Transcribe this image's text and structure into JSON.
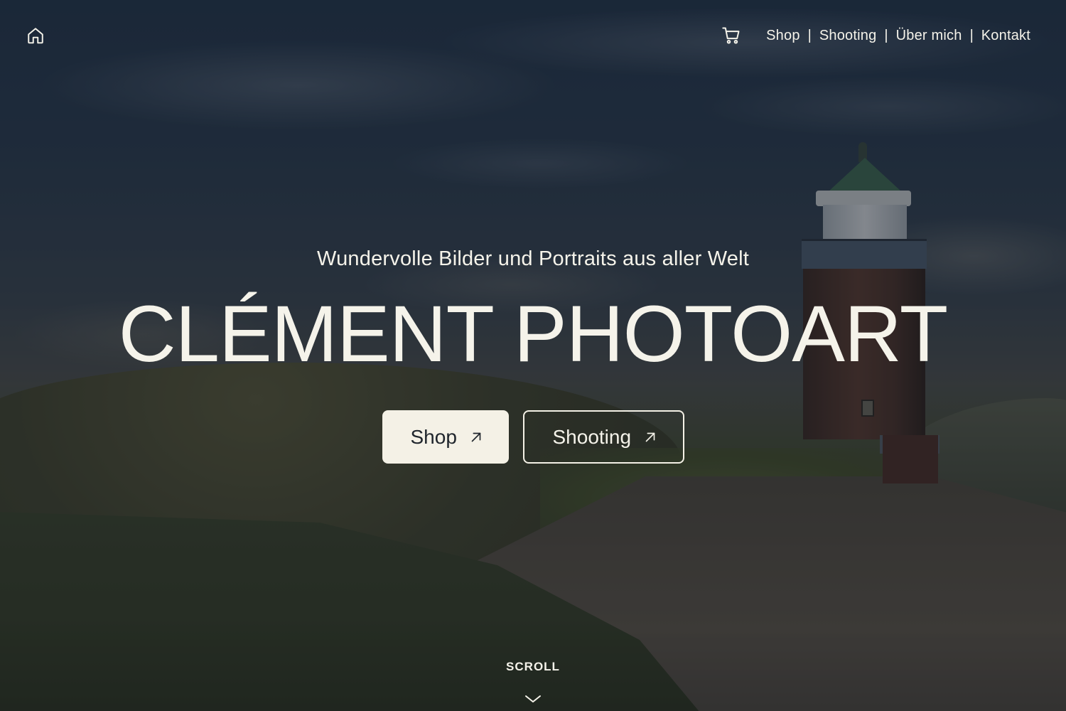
{
  "nav": {
    "home_icon": "home-icon",
    "cart_icon": "cart-icon",
    "items": [
      {
        "label": "Shop"
      },
      {
        "label": "Shooting"
      },
      {
        "label": "Über mich"
      },
      {
        "label": "Kontakt"
      }
    ],
    "separator": "|"
  },
  "hero": {
    "tagline": "Wundervolle Bilder und Portraits aus aller Welt",
    "title": "CLÉMENT PHOTOART",
    "buttons": {
      "shop_label": "Shop",
      "shooting_label": "Shooting",
      "arrow_icon": "arrow-up-right-icon"
    }
  },
  "scroll": {
    "label": "SCROLL",
    "icon": "chevron-down-icon"
  },
  "colors": {
    "text": "#f5f3ea",
    "button_fill": "#f4f1e6",
    "button_text": "#1f252c"
  }
}
